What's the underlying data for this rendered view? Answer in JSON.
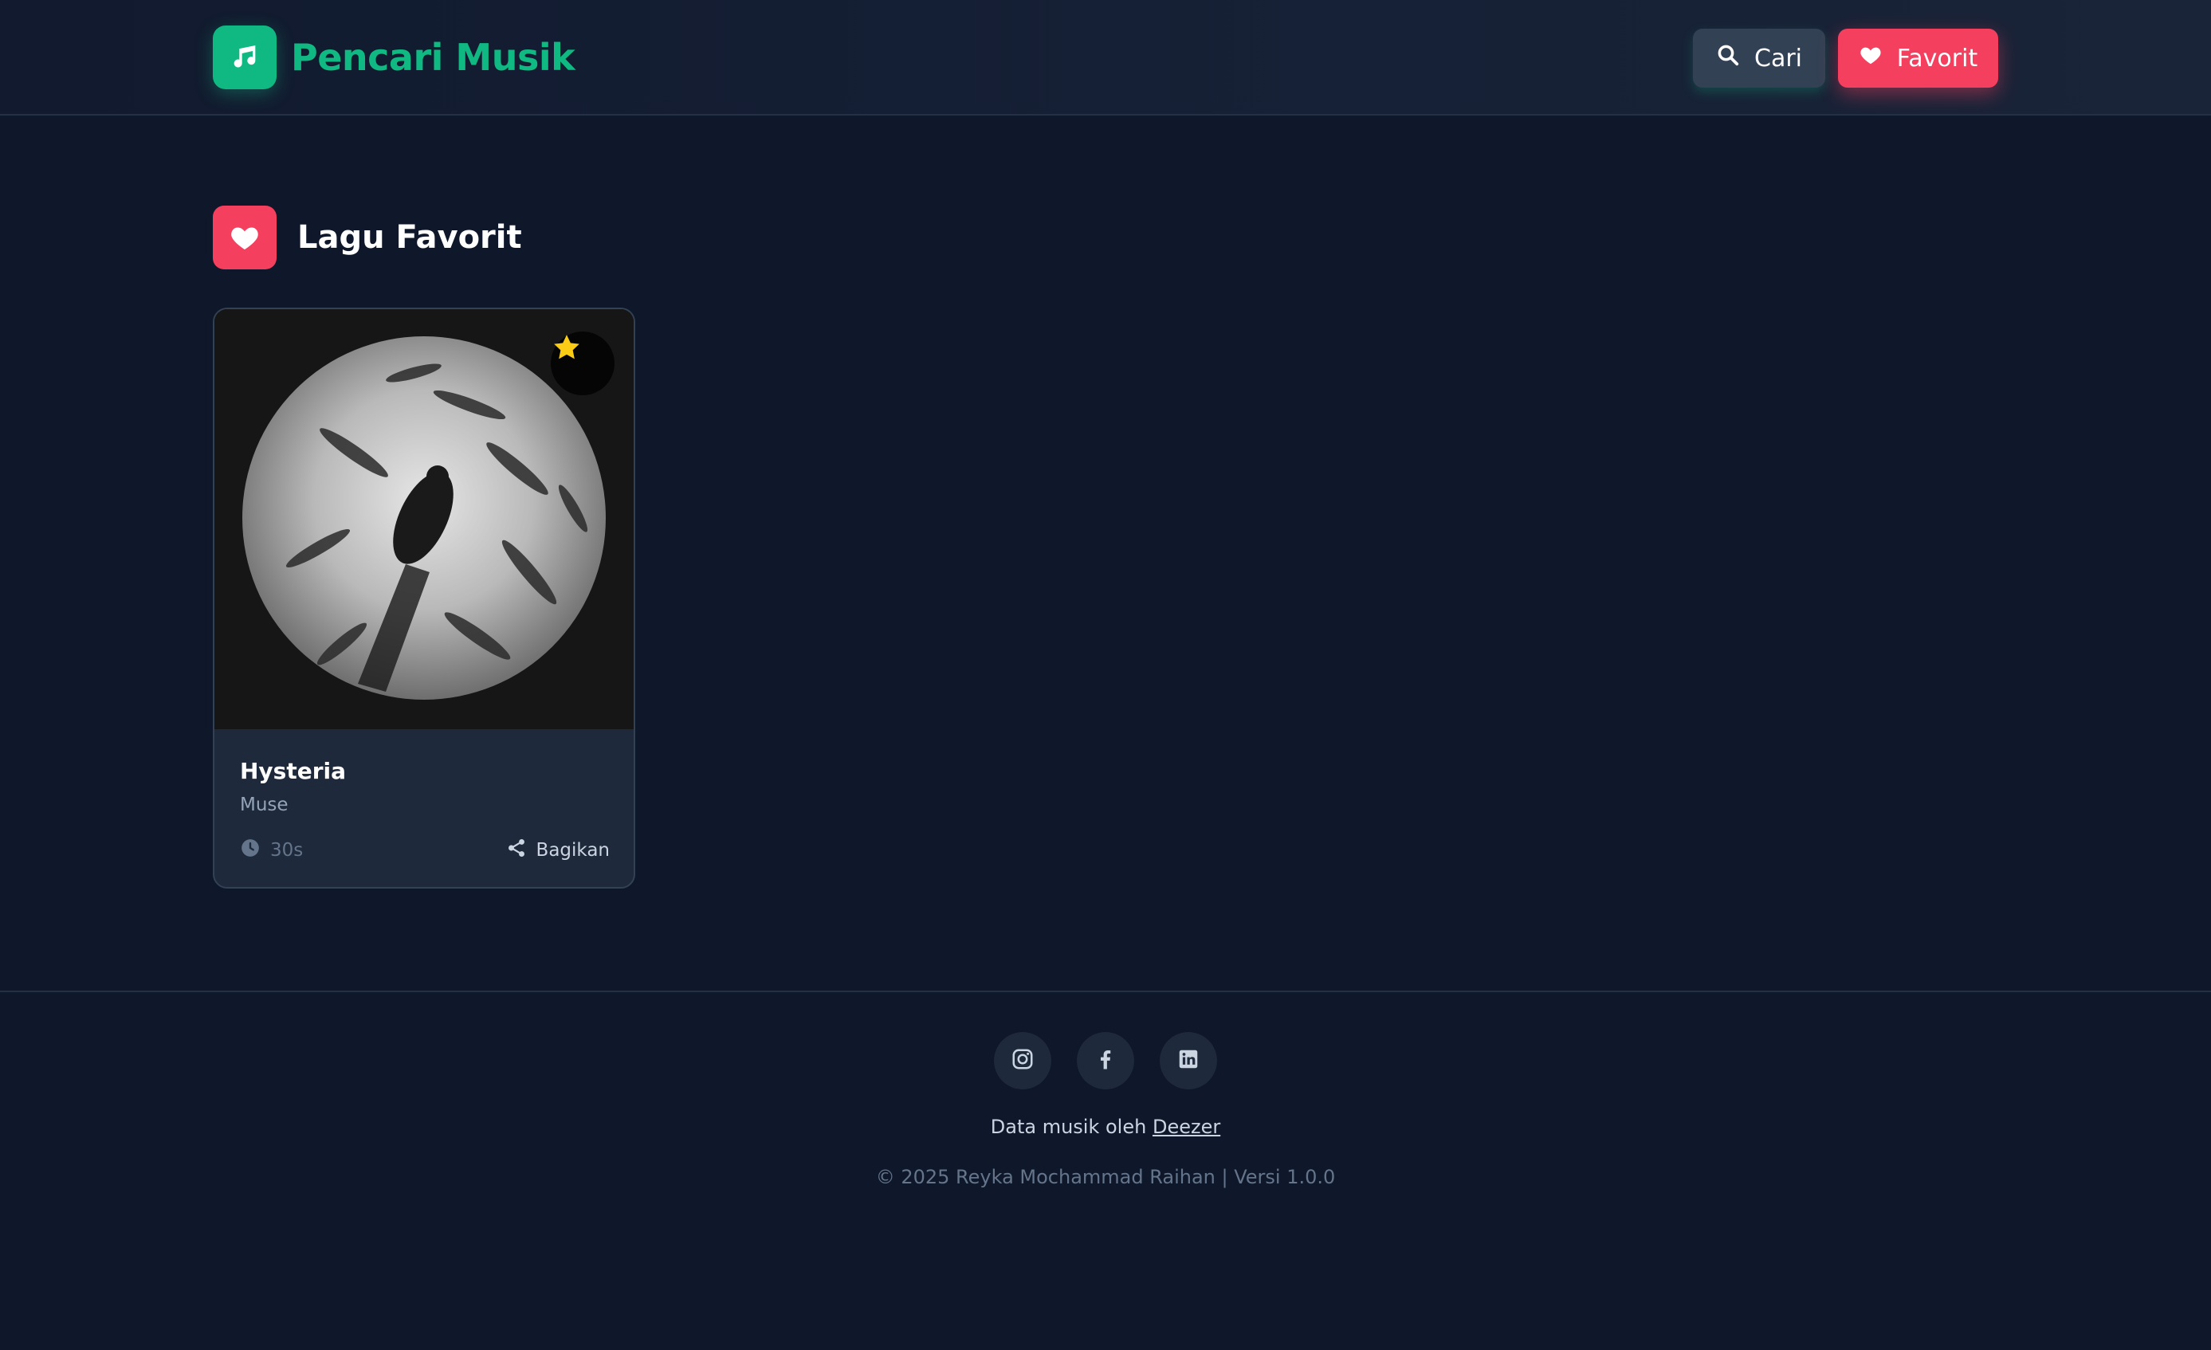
{
  "header": {
    "brand_title": "Pencari Musik",
    "search_label": "Cari",
    "favorite_label": "Favorit"
  },
  "section": {
    "title": "Lagu Favorit"
  },
  "songs": [
    {
      "title": "Hysteria",
      "artist": "Muse",
      "duration": "30s",
      "share_label": "Bagikan",
      "favorited": true
    }
  ],
  "footer": {
    "socials": [
      "instagram-icon",
      "facebook-icon",
      "linkedin-icon"
    ],
    "credit_prefix": "Data musik oleh",
    "credit_link": "Deezer",
    "copyright": "© 2025 Reyka Mochammad Raihan | Versi 1.0.0"
  },
  "colors": {
    "background": "#0f172a",
    "brand_green": "#10b981",
    "favorite_red": "#f43f5e",
    "star_yellow": "#facc15",
    "card": "#1e293b"
  }
}
